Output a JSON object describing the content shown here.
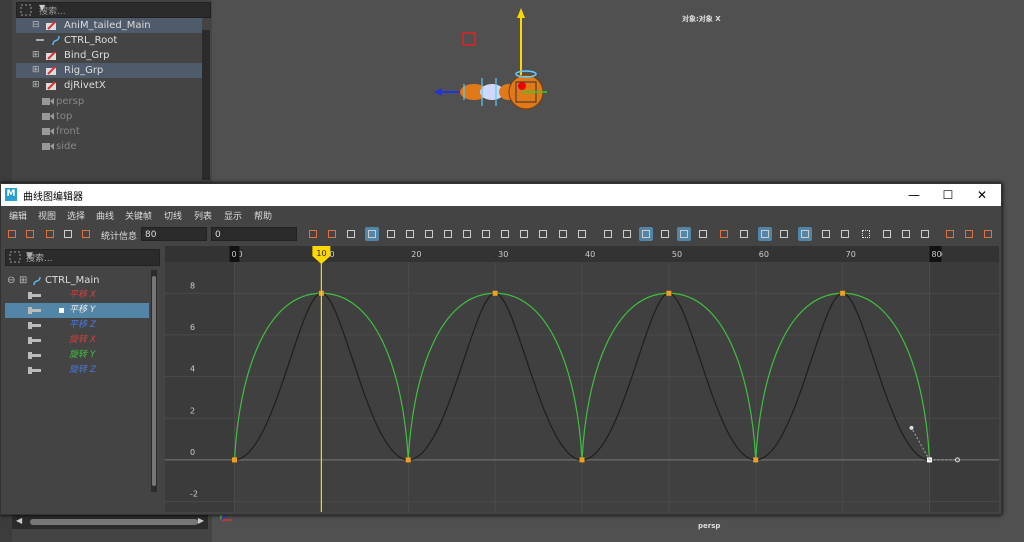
{
  "outliner": {
    "search_placeholder": "搜索...",
    "items": [
      {
        "label": "AniM_tailed_Main",
        "expand": "⊟",
        "icon": "group-icon"
      },
      {
        "label": "CTRL_Root",
        "expand": "",
        "icon": "curve-icon"
      },
      {
        "label": "Bind_Grp",
        "expand": "⊞",
        "icon": "group-icon"
      },
      {
        "label": "Rig_Grp",
        "expand": "⊞",
        "icon": "group-icon"
      },
      {
        "label": "djRivetX",
        "expand": "⊞",
        "icon": "group-icon"
      },
      {
        "label": "persp",
        "expand": "",
        "icon": "camera-icon"
      },
      {
        "label": "top",
        "expand": "",
        "icon": "camera-icon"
      },
      {
        "label": "front",
        "expand": "",
        "icon": "camera-icon"
      },
      {
        "label": "side",
        "expand": "",
        "icon": "camera-icon"
      }
    ]
  },
  "viewport": {
    "hud_label": "对象:对象 X",
    "camera_label": "persp"
  },
  "graph_editor": {
    "title": "曲线图编辑器",
    "window_buttons": {
      "minimize": "—",
      "maximize": "☐",
      "close": "✕"
    },
    "menu": [
      "编辑",
      "视图",
      "选择",
      "曲线",
      "关键帧",
      "切线",
      "列表",
      "显示",
      "帮助"
    ],
    "stats_label": "统计信息",
    "stats_value": "80",
    "value_field": "0",
    "search_placeholder": "搜索...",
    "object": {
      "label": "CTRL_Main"
    },
    "channels": [
      {
        "label": "平移 X",
        "color": "#d04040",
        "selected": false
      },
      {
        "label": "平移 Y",
        "color": "#e8e8e8",
        "selected": true
      },
      {
        "label": "平移 Z",
        "color": "#4a78d8",
        "selected": false
      },
      {
        "label": "旋转 X",
        "color": "#d04040",
        "selected": false
      },
      {
        "label": "旋转 Y",
        "color": "#3fbf3f",
        "selected": false
      },
      {
        "label": "旋转 Z",
        "color": "#4a78d8",
        "selected": false
      }
    ],
    "current_frame": "10",
    "range_start": "0",
    "range_end": "80"
  },
  "chart_data": {
    "type": "line",
    "x_ticks": [
      0,
      10,
      20,
      30,
      40,
      50,
      60,
      70,
      80
    ],
    "y_ticks": [
      -2,
      0,
      2,
      4,
      6,
      8
    ],
    "xlim": [
      -8,
      88
    ],
    "ylim": [
      -2.5,
      9.5
    ],
    "current_frame": 10,
    "keys": [
      {
        "x": 0,
        "y": 0
      },
      {
        "x": 10,
        "y": 8
      },
      {
        "x": 20,
        "y": 0
      },
      {
        "x": 30,
        "y": 8
      },
      {
        "x": 40,
        "y": 0
      },
      {
        "x": 50,
        "y": 8
      },
      {
        "x": 60,
        "y": 0
      },
      {
        "x": 70,
        "y": 8
      },
      {
        "x": 80,
        "y": 0
      }
    ],
    "series": [
      {
        "color": "#3fbf3f",
        "style": "ease"
      },
      {
        "color": "#1e1e1e",
        "style": "smooth"
      }
    ]
  }
}
